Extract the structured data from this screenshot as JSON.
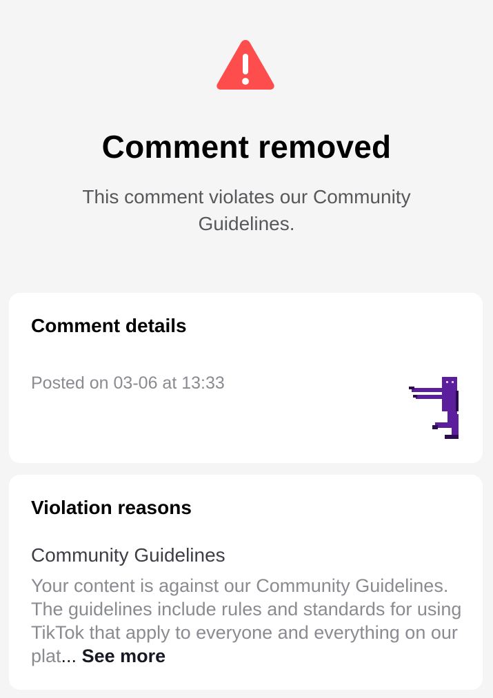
{
  "header": {
    "icon": "warning-triangle-icon",
    "title": "Comment removed",
    "subtitle": "This comment violates our Community Guidelines."
  },
  "comment_details": {
    "title": "Comment details",
    "posted": "Posted on 03-06 at 13:33",
    "sticker": "purple-pixel-character-sticker"
  },
  "violation": {
    "title": "Violation reasons",
    "reason_title": "Community Guidelines",
    "reason_body": "Your content is against our Community Guidelines. The guidelines include rules and standards for using TikTok that apply to everyone and everything on our plat",
    "ellipsis": "...",
    "see_more": "See more"
  },
  "colors": {
    "background": "#f5f5f5",
    "card": "#ffffff",
    "warning_red": "#fe4d4d",
    "title": "#000000",
    "muted_text": "#8a8b91",
    "sticker_purple": "#5b1f9e"
  }
}
